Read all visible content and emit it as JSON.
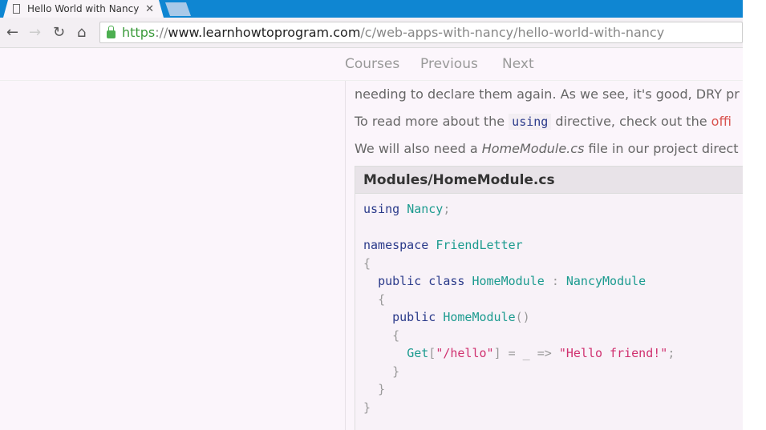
{
  "browser": {
    "tab_title": "Hello World with Nancy",
    "url_scheme": "https",
    "url_sep": "://",
    "url_host": "www.learnhowtoprogram.com",
    "url_path": "/c/web-apps-with-nancy/hello-world-with-nancy"
  },
  "nav": {
    "courses": "Courses",
    "previous": "Previous",
    "next": "Next"
  },
  "content": {
    "p1": "needing to declare them again. As we see, it's good, DRY pr",
    "p2_pre": "To read more about the ",
    "p2_code": "using",
    "p2_post": " directive, check out the ",
    "p2_link": "offi",
    "p3_pre": "We will also need a ",
    "p3_em": "HomeModule.cs",
    "p3_post": " file in our project direct",
    "code_title": "Modules/HomeModule.cs"
  },
  "code": {
    "using": "using",
    "nancy": "Nancy",
    "namespace": "namespace",
    "friendletter": "FriendLetter",
    "public": "public",
    "class": "class",
    "homemodule": "HomeModule",
    "nancymodule": "NancyModule",
    "get": "Get",
    "route": "\"/hello\"",
    "response": "\"Hello friend!\""
  }
}
